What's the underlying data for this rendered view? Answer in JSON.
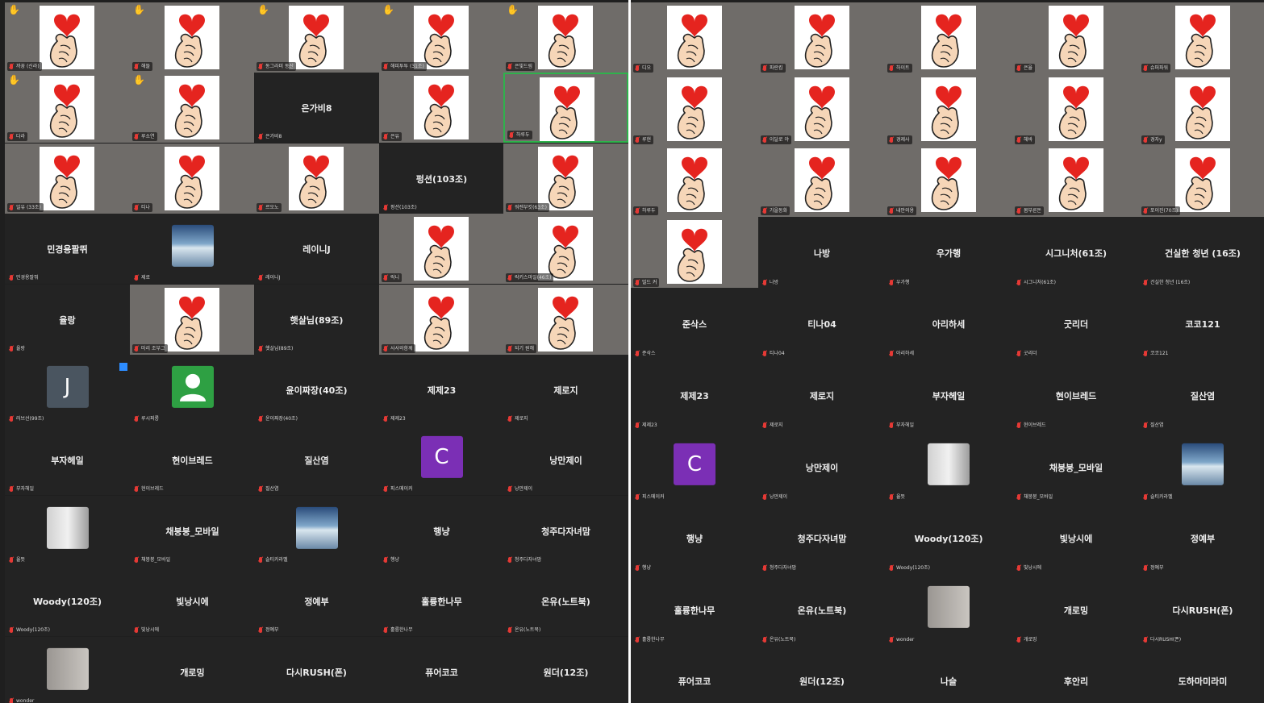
{
  "colors": {
    "tile_bg": "#232323",
    "panel_bg": "#1f1f1f",
    "active_speaker": "#2fb24c",
    "muted": "#e53935",
    "accent": "#2d8cff"
  },
  "icons": {
    "sticker": "heart-finger-sticker-icon",
    "muted": "mic-muted-icon",
    "raised_hand": "raised-hand-icon"
  },
  "left_panel": {
    "top_banner": "",
    "tiles": [
      {
        "name": "",
        "label": "까꿍 (신라)",
        "kind": "video",
        "bg": "bg-room",
        "sticker": true,
        "hand": true
      },
      {
        "name": "",
        "label": "해뜰",
        "kind": "video",
        "bg": "bg-room",
        "sticker": true,
        "hand": true
      },
      {
        "name": "",
        "label": "동그라미 동산",
        "kind": "video",
        "bg": "bg-room",
        "sticker": true,
        "hand": true
      },
      {
        "name": "",
        "label": "해피투투 (31조)",
        "kind": "video",
        "bg": "bg-wall",
        "sticker": true,
        "hand": true
      },
      {
        "name": "",
        "label": "은빛드림",
        "kind": "video",
        "bg": "bg-room",
        "sticker": true,
        "hand": true
      },
      {
        "name": "",
        "label": "다라",
        "kind": "video",
        "bg": "bg-bridge",
        "sticker": true,
        "hand": true
      },
      {
        "name": "",
        "label": "루소연",
        "kind": "video",
        "bg": "bg-bridge",
        "sticker": true,
        "hand": true
      },
      {
        "name": "은가비8",
        "label": "은가비8",
        "kind": "name"
      },
      {
        "name": "",
        "label": "은유",
        "kind": "video",
        "bg": "bg-room",
        "sticker": true
      },
      {
        "name": "",
        "label": "하루두",
        "kind": "video",
        "bg": "bg-dark",
        "sticker": true,
        "active": true
      },
      {
        "name": "",
        "label": "일유 (33조)",
        "kind": "video",
        "bg": "bg-room",
        "sticker": true
      },
      {
        "name": "",
        "label": "티나",
        "kind": "video",
        "bg": "bg-dark",
        "sticker": true
      },
      {
        "name": "",
        "label": "르오노",
        "kind": "video",
        "bg": "bg-wall",
        "sticker": true
      },
      {
        "name": "펑션(103조)",
        "label": "펑션(103조)",
        "kind": "name"
      },
      {
        "name": "",
        "label": "워렌부킷(63조)",
        "kind": "video",
        "bg": "bg-city",
        "sticker": true
      },
      {
        "name": "민경용팔뛰",
        "label": "민경용팔뛰",
        "kind": "name"
      },
      {
        "name": "",
        "label": "제로",
        "kind": "avatar",
        "avatar": "scene",
        "scene": "bg-sea"
      },
      {
        "name": "레이니J",
        "label": "레이니J",
        "kind": "name"
      },
      {
        "name": "",
        "label": "락니",
        "kind": "video",
        "bg": "bg-shelf",
        "sticker": true
      },
      {
        "name": "",
        "label": "락키스마일(46조)",
        "kind": "video",
        "bg": "bg-warm",
        "sticker": true
      },
      {
        "name": "율랑",
        "label": "율랑",
        "kind": "name"
      },
      {
        "name": "",
        "label": "마리 조부그",
        "kind": "video",
        "bg": "bg-room",
        "sticker": true
      },
      {
        "name": "햇살님(89조)",
        "label": "햇살님(89조)",
        "kind": "name"
      },
      {
        "name": "",
        "label": "사사와함께",
        "kind": "video",
        "bg": "bg-room",
        "sticker": true
      },
      {
        "name": "",
        "label": "되기 원해",
        "kind": "video",
        "bg": "bg-bokeh",
        "sticker": true
      },
      {
        "name": "",
        "label": "러브선(99조)",
        "kind": "avatar",
        "avatar": "letter",
        "letter": "J",
        "color": "#4a5560"
      },
      {
        "name": "",
        "label": "루시퍼롱",
        "kind": "avatar",
        "avatar": "person",
        "color": "#2ea043"
      },
      {
        "name": "윤이짜장(40조)",
        "label": "윤이짜장(40조)",
        "kind": "name"
      },
      {
        "name": "제제23",
        "label": "제제23",
        "kind": "name"
      },
      {
        "name": "제로지",
        "label": "제로지",
        "kind": "name"
      },
      {
        "name": "부자헤일",
        "label": "부자헤일",
        "kind": "name"
      },
      {
        "name": "현이브레드",
        "label": "현이브레드",
        "kind": "name"
      },
      {
        "name": "질산염",
        "label": "질산염",
        "kind": "name"
      },
      {
        "name": "",
        "label": "피스메이커",
        "kind": "avatar",
        "avatar": "letter",
        "letter": "C",
        "color": "#7b2fb5"
      },
      {
        "name": "낭만제이",
        "label": "낭만제이",
        "kind": "name"
      },
      {
        "name": "",
        "label": "율뜻",
        "kind": "avatar",
        "avatar": "scene",
        "scene": "bg-shelf"
      },
      {
        "name": "채붕붕_모바일",
        "label": "채붕붕_모바일",
        "kind": "name"
      },
      {
        "name": "",
        "label": "슬티카라멜",
        "kind": "avatar",
        "avatar": "scene",
        "scene": "bg-sea"
      },
      {
        "name": "행냥",
        "label": "행냥",
        "kind": "name"
      },
      {
        "name": "청주다자녀맘",
        "label": "청주다자녀맘",
        "kind": "name"
      },
      {
        "name": "Woody(120조)",
        "label": "Woody(120조)",
        "kind": "name"
      },
      {
        "name": "빛낭시에",
        "label": "빛낭시에",
        "kind": "name"
      },
      {
        "name": "정예부",
        "label": "정예부",
        "kind": "name"
      },
      {
        "name": "훌륭한나무",
        "label": "훌륭한나무",
        "kind": "name"
      },
      {
        "name": "온유(노트북)",
        "label": "온유(노트북)",
        "kind": "name"
      },
      {
        "name": "",
        "label": "wonder",
        "kind": "avatar",
        "avatar": "scene",
        "scene": "bg-wall"
      },
      {
        "name": "개로밍",
        "label": "",
        "kind": "name"
      },
      {
        "name": "다시RUSH(폰)",
        "label": "",
        "kind": "name"
      },
      {
        "name": "퓨어코코",
        "label": "",
        "kind": "name"
      },
      {
        "name": "원더(12조)",
        "label": "",
        "kind": "name"
      }
    ]
  },
  "right_panel": {
    "tiles": [
      {
        "name": "",
        "label": "디오",
        "kind": "video",
        "bg": "bg-dark",
        "sticker": true
      },
      {
        "name": "",
        "label": "파란킴",
        "kind": "video",
        "bg": "bg-beach",
        "sticker": true
      },
      {
        "name": "",
        "label": "하이트",
        "kind": "video",
        "bg": "bg-yellow",
        "sticker": true
      },
      {
        "name": "",
        "label": "은율",
        "kind": "video",
        "bg": "bg-room",
        "sticker": true
      },
      {
        "name": "",
        "label": "슈퍼파워",
        "kind": "video",
        "bg": "bg-room",
        "sticker": true
      },
      {
        "name": "",
        "label": "루현",
        "kind": "video",
        "bg": "bg-dark",
        "sticker": true
      },
      {
        "name": "",
        "label": "이달로 야",
        "kind": "video",
        "bg": "bg-room",
        "sticker": true
      },
      {
        "name": "",
        "label": "경제사",
        "kind": "video",
        "bg": "bg-room",
        "sticker": true
      },
      {
        "name": "",
        "label": "헤바",
        "kind": "video",
        "bg": "bg-room",
        "sticker": true
      },
      {
        "name": "",
        "label": "경자y",
        "kind": "video",
        "bg": "bg-dark",
        "sticker": true
      },
      {
        "name": "",
        "label": "하루두",
        "kind": "video",
        "bg": "bg-bridge",
        "sticker": true
      },
      {
        "name": "",
        "label": "가을동화",
        "kind": "video",
        "bg": "bg-room",
        "sticker": true
      },
      {
        "name": "",
        "label": "내안의용",
        "kind": "video",
        "bg": "bg-dark",
        "sticker": true
      },
      {
        "name": "",
        "label": "봄부른돈",
        "kind": "video",
        "bg": "bg-room",
        "sticker": true
      },
      {
        "name": "",
        "label": "포이진(70조)",
        "kind": "video",
        "bg": "bg-bridge",
        "sticker": true
      },
      {
        "name": "",
        "label": "밀드 커",
        "kind": "video",
        "bg": "bg-room",
        "sticker": true
      },
      {
        "name": "나방",
        "label": "나방",
        "kind": "name"
      },
      {
        "name": "우가행",
        "label": "우가행",
        "kind": "name"
      },
      {
        "name": "시그니처(61조)",
        "label": "시그니처(61조)",
        "kind": "name"
      },
      {
        "name": "건실한 청년 (16조)",
        "label": "건실한 청년 (16조)",
        "kind": "name"
      },
      {
        "name": "준삭스",
        "label": "준삭스",
        "kind": "name"
      },
      {
        "name": "티나04",
        "label": "티나04",
        "kind": "name"
      },
      {
        "name": "아리하세",
        "label": "아리하세",
        "kind": "name"
      },
      {
        "name": "굿리더",
        "label": "굿리더",
        "kind": "name"
      },
      {
        "name": "코코121",
        "label": "코코121",
        "kind": "name"
      },
      {
        "name": "제제23",
        "label": "제제23",
        "kind": "name"
      },
      {
        "name": "제로지",
        "label": "제로지",
        "kind": "name"
      },
      {
        "name": "부자헤일",
        "label": "부자헤일",
        "kind": "name"
      },
      {
        "name": "현이브레드",
        "label": "현이브레드",
        "kind": "name"
      },
      {
        "name": "질산염",
        "label": "질산염",
        "kind": "name"
      },
      {
        "name": "",
        "label": "피스메이커",
        "kind": "avatar",
        "avatar": "letter",
        "letter": "C",
        "color": "#7b2fb5"
      },
      {
        "name": "낭만제이",
        "label": "낭만제이",
        "kind": "name"
      },
      {
        "name": "",
        "label": "율뜻",
        "kind": "avatar",
        "avatar": "scene",
        "scene": "bg-shelf"
      },
      {
        "name": "채붕붕_모바일",
        "label": "채붕붕_모바일",
        "kind": "name"
      },
      {
        "name": "",
        "label": "슬티카라멜",
        "kind": "avatar",
        "avatar": "scene",
        "scene": "bg-sea"
      },
      {
        "name": "행냥",
        "label": "행냥",
        "kind": "name"
      },
      {
        "name": "청주다자녀맘",
        "label": "청주다자녀맘",
        "kind": "name"
      },
      {
        "name": "Woody(120조)",
        "label": "Woody(120조)",
        "kind": "name"
      },
      {
        "name": "빛낭시에",
        "label": "빛낭시에",
        "kind": "name"
      },
      {
        "name": "정예부",
        "label": "정예부",
        "kind": "name"
      },
      {
        "name": "훌륭한나무",
        "label": "훌륭한나무",
        "kind": "name"
      },
      {
        "name": "온유(노트북)",
        "label": "온유(노트북)",
        "kind": "name"
      },
      {
        "name": "",
        "label": "wonder",
        "kind": "avatar",
        "avatar": "scene",
        "scene": "bg-wall"
      },
      {
        "name": "개로밍",
        "label": "개로밍",
        "kind": "name"
      },
      {
        "name": "다시RUSH(폰)",
        "label": "다시RUSH(폰)",
        "kind": "name"
      },
      {
        "name": "퓨어코코",
        "label": "",
        "kind": "name"
      },
      {
        "name": "원더(12조)",
        "label": "",
        "kind": "name"
      },
      {
        "name": "나슬",
        "label": "",
        "kind": "name"
      },
      {
        "name": "후안리",
        "label": "",
        "kind": "name"
      },
      {
        "name": "도하마미라미",
        "label": "",
        "kind": "name"
      }
    ]
  }
}
